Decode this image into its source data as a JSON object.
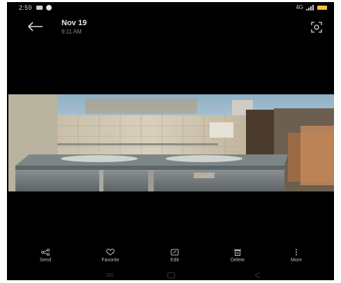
{
  "status": {
    "time": "2:59",
    "network": "4G"
  },
  "header": {
    "date": "Nov 19",
    "time": "9:11 AM",
    "back_icon": "back-arrow-icon",
    "lens_icon": "lens-icon"
  },
  "actions": [
    {
      "label": "Send",
      "icon": "share-icon"
    },
    {
      "label": "Favorite",
      "icon": "heart-icon"
    },
    {
      "label": "Edit",
      "icon": "edit-icon"
    },
    {
      "label": "Delete",
      "icon": "trash-icon"
    },
    {
      "label": "More",
      "icon": "more-icon"
    }
  ],
  "colors": {
    "background": "#000000",
    "text_primary": "#e8e8e8",
    "text_secondary": "#888888",
    "battery": "#f0c040"
  }
}
